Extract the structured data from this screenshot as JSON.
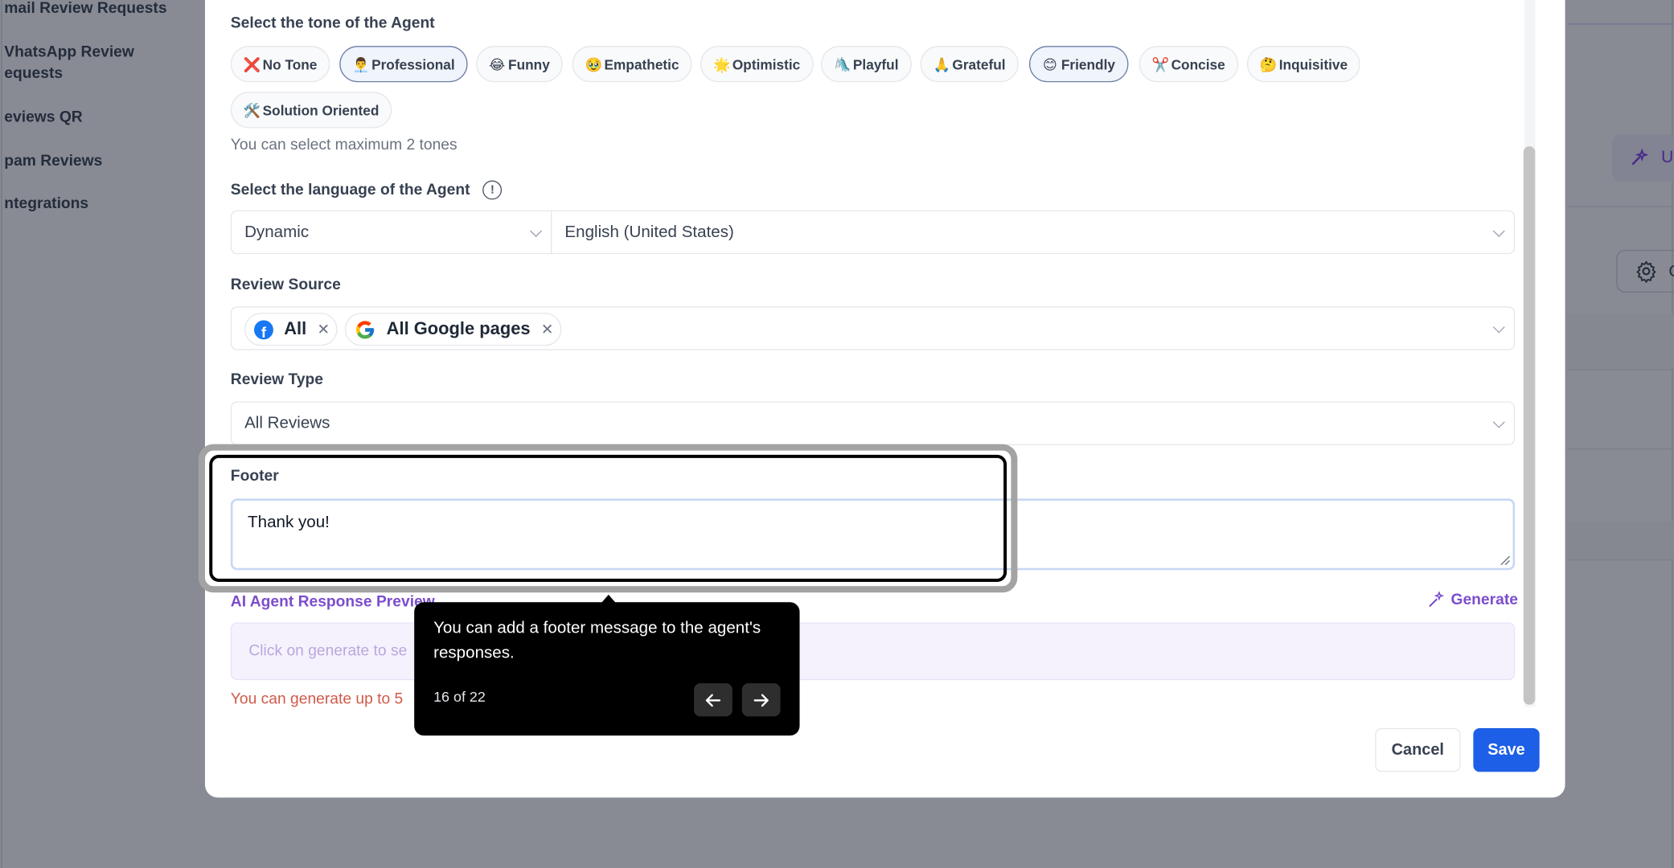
{
  "sidebar": {
    "items": [
      {
        "label": "mail Review Requests"
      },
      {
        "label": "VhatsApp Review"
      },
      {
        "label": "equests"
      },
      {
        "label": "eviews QR"
      },
      {
        "label": "pam Reviews"
      },
      {
        "label": "ntegrations"
      }
    ]
  },
  "background": {
    "purple_button_text": "U",
    "gear_button_text": "C"
  },
  "modal": {
    "tone_label": "Select the tone of the Agent",
    "tones": [
      {
        "emoji": "❌",
        "label": "No Tone",
        "selected": false
      },
      {
        "emoji": "👨‍💼",
        "label": "Professional",
        "selected": true
      },
      {
        "emoji": "😂",
        "label": "Funny",
        "selected": false
      },
      {
        "emoji": "🥹",
        "label": "Empathetic",
        "selected": false
      },
      {
        "emoji": "🌟",
        "label": "Optimistic",
        "selected": false
      },
      {
        "emoji": "🛝",
        "label": "Playful",
        "selected": false
      },
      {
        "emoji": "🙏",
        "label": "Grateful",
        "selected": false
      },
      {
        "emoji": "😊",
        "label": "Friendly",
        "selected": true
      },
      {
        "emoji": "✂️",
        "label": "Concise",
        "selected": false
      },
      {
        "emoji": "🤔",
        "label": "Inquisitive",
        "selected": false
      },
      {
        "emoji": "🛠️",
        "label": "Solution Oriented",
        "selected": false
      }
    ],
    "tone_hint": "You can select maximum 2 tones",
    "language_label": "Select the language of the Agent",
    "language_mode": "Dynamic",
    "language_value": "English (United States)",
    "review_source_label": "Review Source",
    "review_sources": [
      {
        "label": "All",
        "icon": "facebook-icon"
      },
      {
        "label": "All Google pages",
        "icon": "google-icon"
      }
    ],
    "review_type_label": "Review Type",
    "review_type_value": "All Reviews",
    "footer_label": "Footer",
    "footer_value": "Thank you!",
    "preview_title": "AI Agent Response Preview",
    "generate_label": "Generate",
    "preview_placeholder": "Click on generate to se",
    "limit_text": "You can generate up to 5",
    "cancel_label": "Cancel",
    "save_label": "Save"
  },
  "tour": {
    "message": "You can add a footer message to the agent's responses.",
    "progress": "16 of 22",
    "prev_icon": "arrow-left-icon",
    "next_icon": "arrow-right-icon"
  },
  "colors": {
    "primary": "#1d5fe6",
    "accent_purple": "#7c4dcc",
    "error": "#d05a4a",
    "tooltip_bg": "#000000"
  }
}
